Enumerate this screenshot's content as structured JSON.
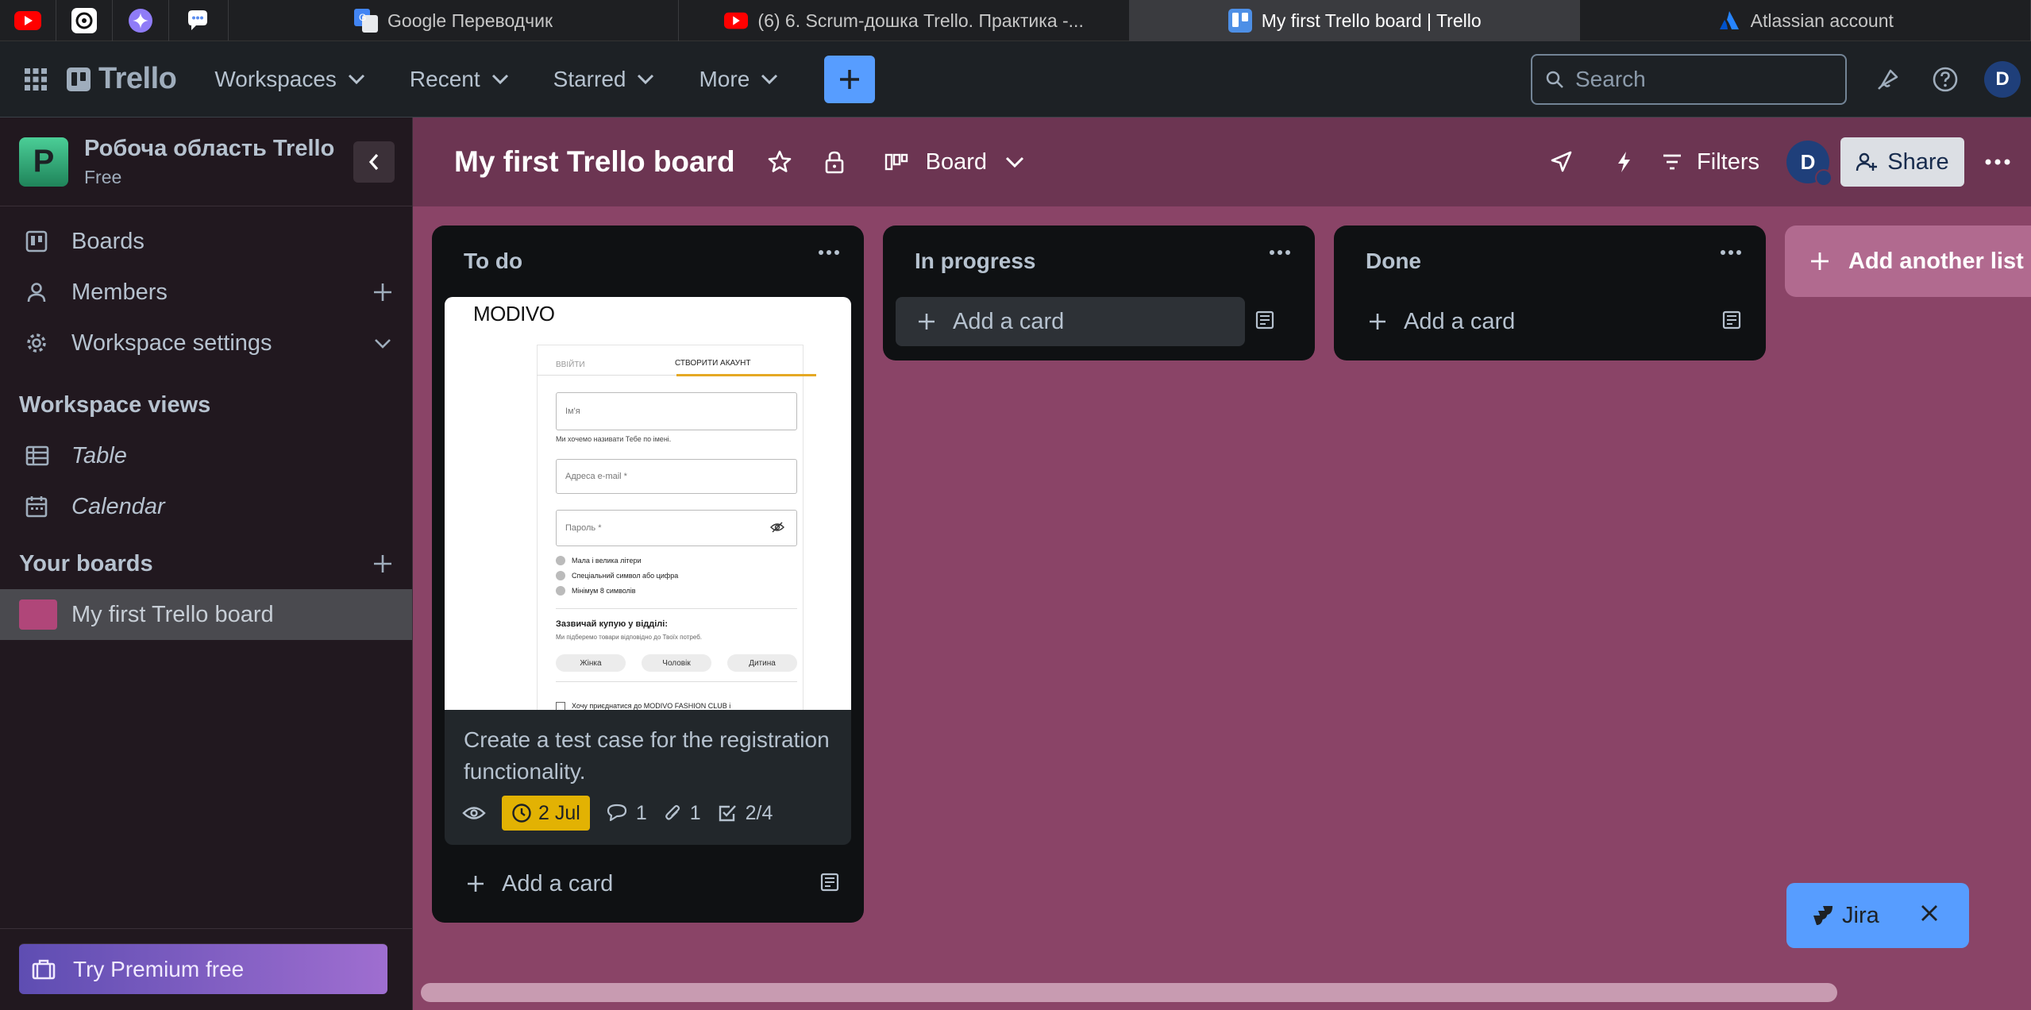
{
  "browser": {
    "pinned": [
      {
        "icon": "youtube-icon",
        "color": "#ff0000"
      },
      {
        "icon": "chatgpt-icon",
        "color": "#ffffff"
      },
      {
        "icon": "gemini-icon",
        "color": "#8f7cf7"
      },
      {
        "icon": "chat-bubble-icon",
        "color": "#5b8def"
      }
    ],
    "tabs": [
      {
        "title": "Google Переводчик",
        "icon": "google-translate-icon",
        "active": false
      },
      {
        "title": "(6) 6. Scrum-дошка Trello. Практика -...",
        "icon": "youtube-icon",
        "active": false
      },
      {
        "title": "My first Trello board | Trello",
        "icon": "trello-icon",
        "active": true
      },
      {
        "title": "Atlassian account",
        "icon": "atlassian-icon",
        "active": false
      }
    ]
  },
  "header": {
    "logo": "Trello",
    "menus": [
      "Workspaces",
      "Recent",
      "Starred",
      "More"
    ],
    "search_placeholder": "Search",
    "avatar": "D"
  },
  "sidebar": {
    "workspace": {
      "initial": "P",
      "name": "Робоча область Trello",
      "plan": "Free"
    },
    "items": [
      {
        "label": "Boards",
        "icon": "boards-icon"
      },
      {
        "label": "Members",
        "icon": "person-icon"
      },
      {
        "label": "Workspace settings",
        "icon": "gear-icon"
      }
    ],
    "views_heading": "Workspace views",
    "views": [
      {
        "label": "Table",
        "icon": "table-icon"
      },
      {
        "label": "Calendar",
        "icon": "calendar-icon"
      }
    ],
    "boards_heading": "Your boards",
    "boards": [
      {
        "label": "My first Trello board",
        "color": "#b04679"
      }
    ],
    "premium": "Try Premium free"
  },
  "board": {
    "title": "My first Trello board",
    "view": "Board",
    "filters": "Filters",
    "avatar": "D",
    "share": "Share",
    "background": "#8a4467",
    "lists": [
      {
        "title": "To do",
        "add_card": "Add a card",
        "card": {
          "title": "Create a test case for the registration functionality.",
          "due": "2 Jul",
          "comments": "1",
          "attachments": "1",
          "checklist": "2/4",
          "cover": {
            "brand": "MODIVO",
            "tab_login": "ВВІЙТИ",
            "tab_register": "СТВОРИТИ АКАУНТ",
            "name_placeholder": "Ім'я",
            "name_hint": "Ми хочемо називати Тебе по імені.",
            "email_placeholder": "Адреса e-mail *",
            "password_placeholder": "Пароль *",
            "rules": [
              "Мала і велика літери",
              "Спеціальний символ або цифра",
              "Мінімум 8 символів"
            ],
            "section_title": "Зазвичай купую у відділі:",
            "section_hint": "Ми підберемо товари відповідно до Твоїх потреб.",
            "options": [
              "Жінка",
              "Чоловік",
              "Дитина"
            ],
            "footer": "Хочу приєднатися до MODIVO FASHION CLUB і"
          }
        }
      },
      {
        "title": "In progress",
        "add_card": "Add a card"
      },
      {
        "title": "Done",
        "add_card": "Add a card"
      }
    ],
    "add_list": "Add another list"
  },
  "jira": {
    "label": "Jira"
  }
}
